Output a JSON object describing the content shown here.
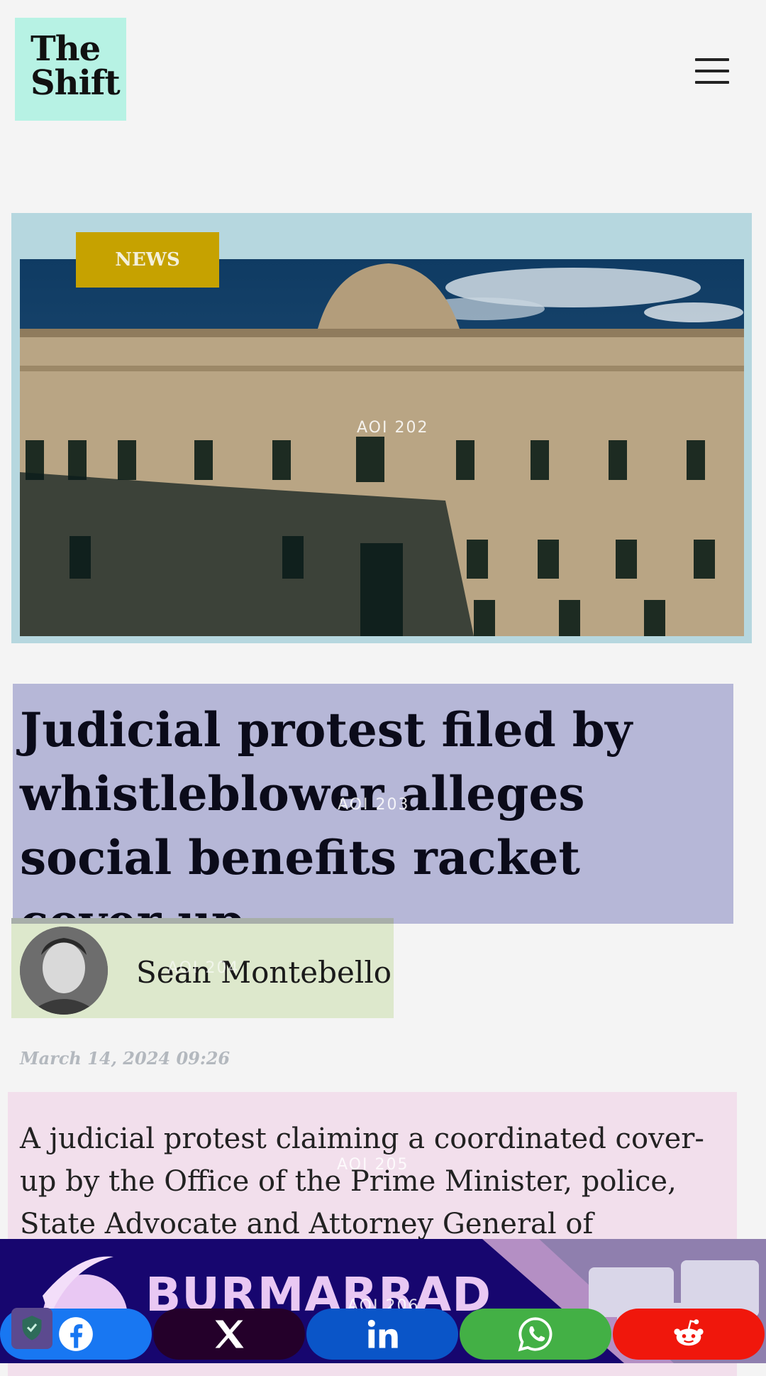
{
  "header": {
    "logo_line1": "The",
    "logo_line2": "Shift",
    "menu_icon": "hamburger-icon"
  },
  "article": {
    "category": "NEWS",
    "headline": "Judicial protest filed by whistleblower alleges social benefits racket cover up",
    "author": "Sean Montebello",
    "date": "March 14, 2024 09:26",
    "body": "A judicial protest claiming a coordinated cover-up by the Office of the Prime Minister, police, State Advocate and Attorney General of"
  },
  "overlays": {
    "aoi_202": "AOI 202",
    "aoi_203": "AOI 203",
    "aoi_204": "AOI 204",
    "aoi_205": "AOI 205",
    "aoi_206": "AOI 206"
  },
  "ad": {
    "title": "BURMARRAD"
  },
  "share": {
    "buttons": [
      {
        "name": "facebook",
        "icon": "facebook-icon",
        "color": "#1877f2"
      },
      {
        "name": "x",
        "icon": "x-icon",
        "color": "#24002a"
      },
      {
        "name": "linkedin",
        "icon": "linkedin-icon",
        "color": "#0a55c8"
      },
      {
        "name": "whatsapp",
        "icon": "whatsapp-icon",
        "color": "#43b045"
      },
      {
        "name": "reddit",
        "icon": "reddit-icon",
        "color": "#f0170c"
      }
    ]
  },
  "colors": {
    "logo_bg": "#b7f2e4",
    "news_badge": "#c6a200",
    "headline_bg": "#b6b7d7",
    "author_bg": "#dde8cc",
    "body_bg": "#f2dfec"
  }
}
